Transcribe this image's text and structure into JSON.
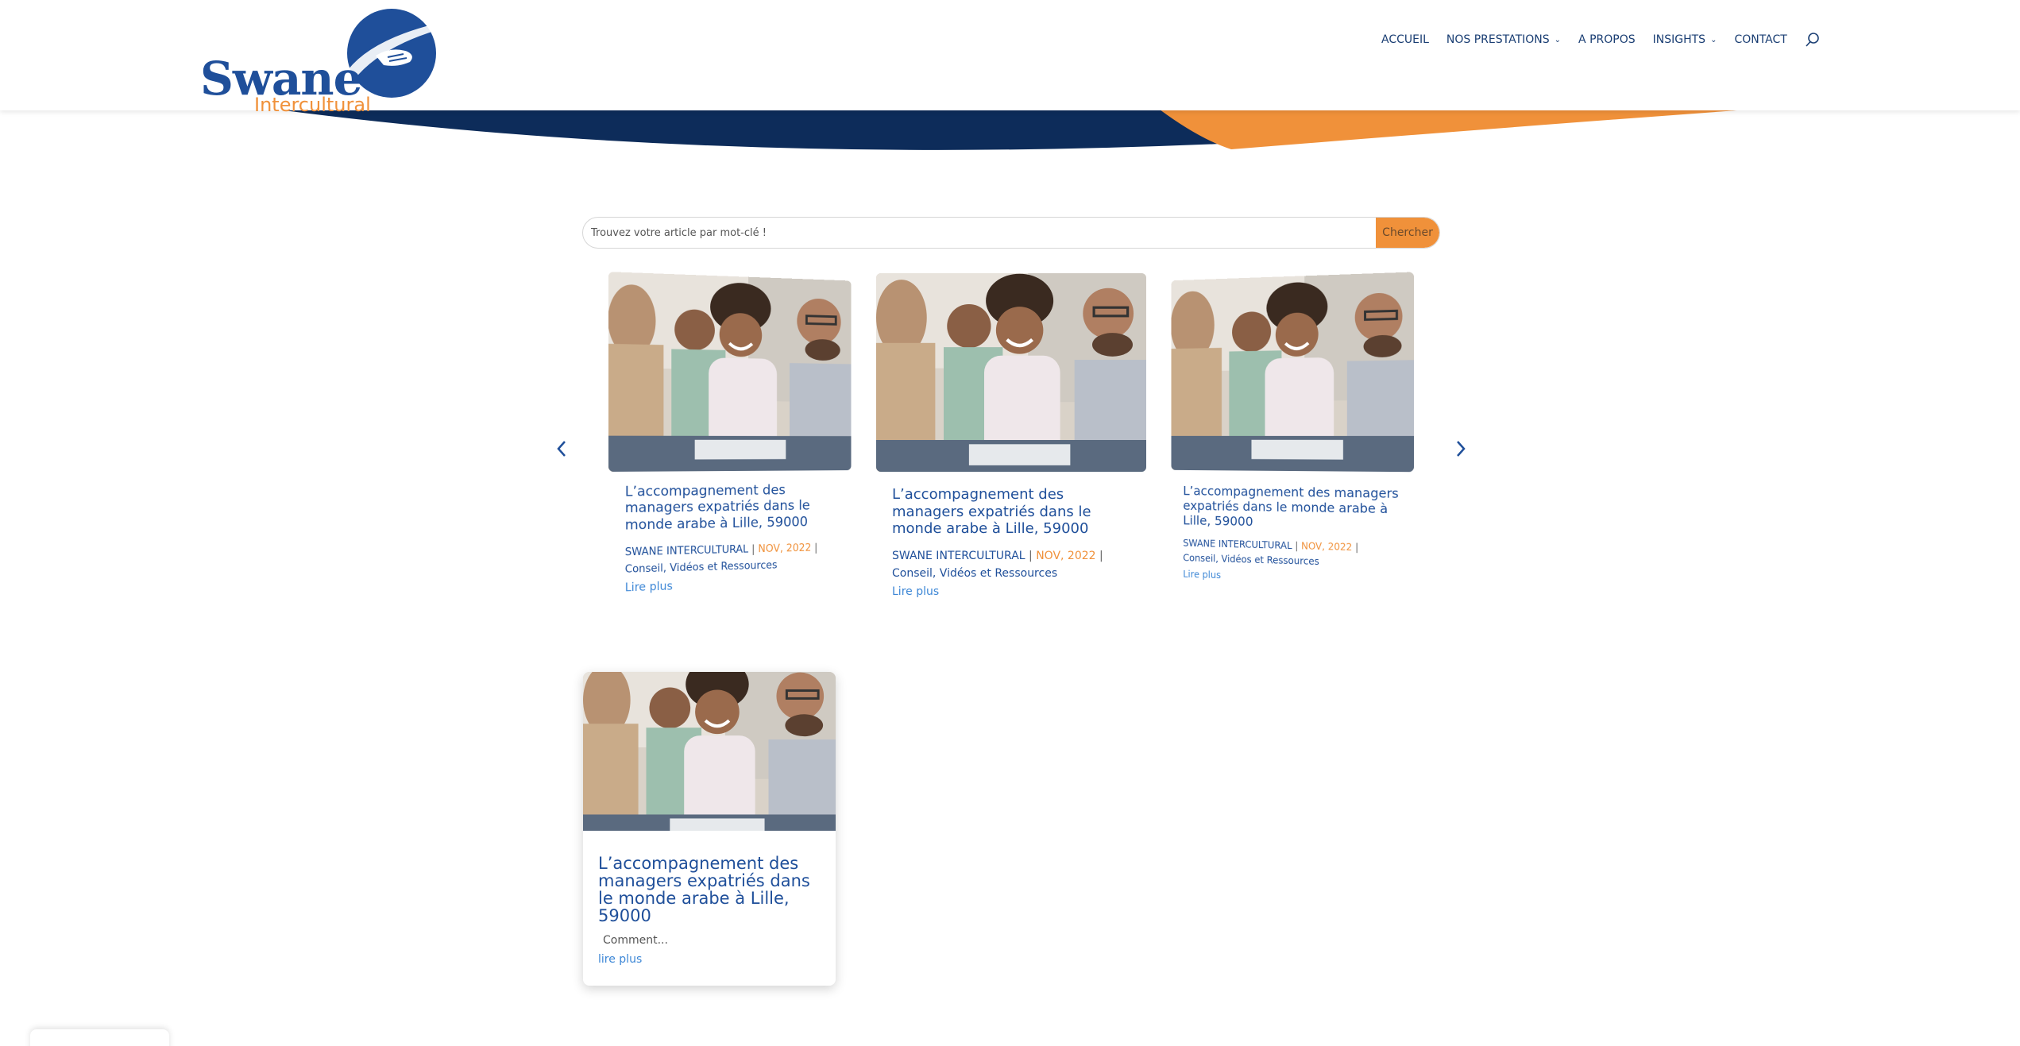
{
  "header": {
    "logo_word": "Swane",
    "logo_sub": "Intercultural",
    "nav": [
      {
        "label": "ACCUEIL",
        "has_dropdown": false
      },
      {
        "label": "NOS PRESTATIONS",
        "has_dropdown": true
      },
      {
        "label": "A PROPOS",
        "has_dropdown": false
      },
      {
        "label": "INSIGHTS",
        "has_dropdown": true
      },
      {
        "label": "CONTACT",
        "has_dropdown": false
      }
    ],
    "search_icon": "search-icon"
  },
  "colors": {
    "brand_blue": "#1f4f9a",
    "navy": "#0d2c5a",
    "orange": "#f0913a",
    "link_blue": "#3d87d6"
  },
  "search": {
    "placeholder": "Trouvez votre article par mot-clé !",
    "button_label": "Chercher"
  },
  "carousel": {
    "prev_icon": "chevron-left-icon",
    "next_icon": "chevron-right-icon",
    "slides": [
      {
        "title": "L’accompagnement des managers expatriés dans le monde arabe à Lille, 59000",
        "author": "SWANE INTERCULTURAL",
        "date": "NOV, 2022",
        "category": "Conseil, Vidéos et Ressources",
        "more": "Lire plus"
      },
      {
        "title": "L’accompagnement des managers expatriés dans le monde arabe à Lille, 59000",
        "author": "SWANE INTERCULTURAL",
        "date": "NOV, 2022",
        "category": "Conseil, Vidéos et Ressources",
        "more": "Lire plus"
      },
      {
        "title": "L’accompagnement des managers expatriés dans le monde arabe à Lille, 59000",
        "author": "SWANE INTERCULTURAL",
        "date": "NOV, 2022",
        "category": "Conseil, Vidéos et Ressources",
        "more": "Lire plus"
      }
    ]
  },
  "grid": {
    "cards": [
      {
        "title": "L’accompagnement des managers expatriés dans le monde arabe à Lille, 59000",
        "excerpt": "Comment...",
        "more": "lire plus"
      }
    ]
  },
  "separator": "|"
}
